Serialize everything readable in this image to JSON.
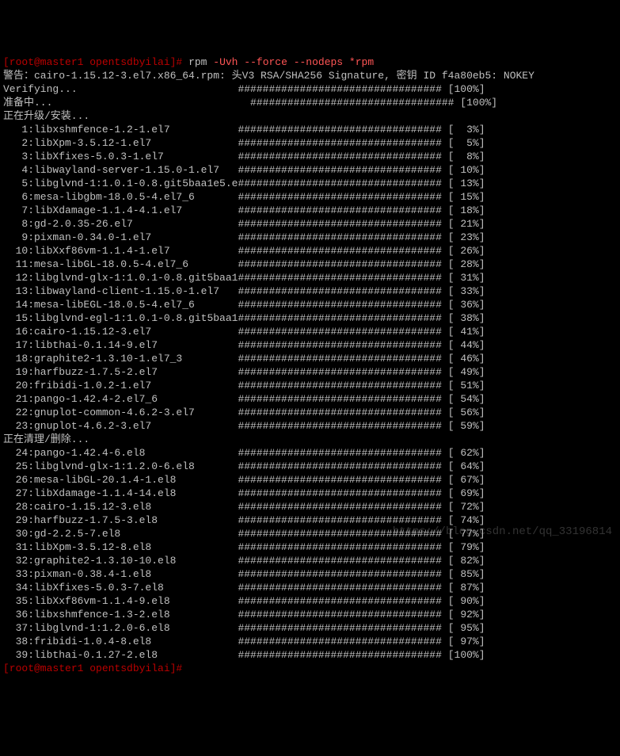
{
  "prompt": {
    "user_host_path": "[root@master1 opentsdbyilai]#",
    "command": "rpm",
    "flags": "-Uvh --force --nodeps",
    "glob": "*rpm"
  },
  "warning_line": "警告：cairo-1.15.12-3.el7.x86_64.rpm: 头V3 RSA/SHA256 Signature, 密钥 ID f4a80eb5: NOKEY",
  "verifying_label": "Verifying...",
  "verifying_bar": "################################# [100%]",
  "preparing_label": "准备中...",
  "preparing_bar": "################################# [100%]",
  "upgrade_header": "正在升级/安装...",
  "cleanup_header": "正在清理/删除...",
  "upgrade_items": [
    {
      "n": " 1",
      "name": "libxshmfence-1.2-1.el7",
      "pct": "  3%"
    },
    {
      "n": " 2",
      "name": "libXpm-3.5.12-1.el7",
      "pct": "  5%"
    },
    {
      "n": " 3",
      "name": "libXfixes-5.0.3-1.el7",
      "pct": "  8%"
    },
    {
      "n": " 4",
      "name": "libwayland-server-1.15.0-1.el7",
      "pct": " 10%"
    },
    {
      "n": " 5",
      "name": "libglvnd-1:1.0.1-0.8.git5baa1e5.e",
      "pct": " 13%"
    },
    {
      "n": " 6",
      "name": "mesa-libgbm-18.0.5-4.el7_6",
      "pct": " 15%"
    },
    {
      "n": " 7",
      "name": "libXdamage-1.1.4-4.1.el7",
      "pct": " 18%"
    },
    {
      "n": " 8",
      "name": "gd-2.0.35-26.el7",
      "pct": " 21%"
    },
    {
      "n": " 9",
      "name": "pixman-0.34.0-1.el7",
      "pct": " 23%"
    },
    {
      "n": "10",
      "name": "libXxf86vm-1.1.4-1.el7",
      "pct": " 26%"
    },
    {
      "n": "11",
      "name": "mesa-libGL-18.0.5-4.el7_6",
      "pct": " 28%"
    },
    {
      "n": "12",
      "name": "libglvnd-glx-1:1.0.1-0.8.git5baa1",
      "pct": " 31%"
    },
    {
      "n": "13",
      "name": "libwayland-client-1.15.0-1.el7",
      "pct": " 33%"
    },
    {
      "n": "14",
      "name": "mesa-libEGL-18.0.5-4.el7_6",
      "pct": " 36%"
    },
    {
      "n": "15",
      "name": "libglvnd-egl-1:1.0.1-0.8.git5baa1",
      "pct": " 38%"
    },
    {
      "n": "16",
      "name": "cairo-1.15.12-3.el7",
      "pct": " 41%"
    },
    {
      "n": "17",
      "name": "libthai-0.1.14-9.el7",
      "pct": " 44%"
    },
    {
      "n": "18",
      "name": "graphite2-1.3.10-1.el7_3",
      "pct": " 46%"
    },
    {
      "n": "19",
      "name": "harfbuzz-1.7.5-2.el7",
      "pct": " 49%"
    },
    {
      "n": "20",
      "name": "fribidi-1.0.2-1.el7",
      "pct": " 51%"
    },
    {
      "n": "21",
      "name": "pango-1.42.4-2.el7_6",
      "pct": " 54%"
    },
    {
      "n": "22",
      "name": "gnuplot-common-4.6.2-3.el7",
      "pct": " 56%"
    },
    {
      "n": "23",
      "name": "gnuplot-4.6.2-3.el7",
      "pct": " 59%"
    }
  ],
  "cleanup_items": [
    {
      "n": "24",
      "name": "pango-1.42.4-6.el8",
      "pct": " 62%"
    },
    {
      "n": "25",
      "name": "libglvnd-glx-1:1.2.0-6.el8",
      "pct": " 64%"
    },
    {
      "n": "26",
      "name": "mesa-libGL-20.1.4-1.el8",
      "pct": " 67%"
    },
    {
      "n": "27",
      "name": "libXdamage-1.1.4-14.el8",
      "pct": " 69%"
    },
    {
      "n": "28",
      "name": "cairo-1.15.12-3.el8",
      "pct": " 72%"
    },
    {
      "n": "29",
      "name": "harfbuzz-1.7.5-3.el8",
      "pct": " 74%"
    },
    {
      "n": "30",
      "name": "gd-2.2.5-7.el8",
      "pct": " 77%"
    },
    {
      "n": "31",
      "name": "libXpm-3.5.12-8.el8",
      "pct": " 79%"
    },
    {
      "n": "32",
      "name": "graphite2-1.3.10-10.el8",
      "pct": " 82%"
    },
    {
      "n": "33",
      "name": "pixman-0.38.4-1.el8",
      "pct": " 85%"
    },
    {
      "n": "34",
      "name": "libXfixes-5.0.3-7.el8",
      "pct": " 87%"
    },
    {
      "n": "35",
      "name": "libXxf86vm-1.1.4-9.el8",
      "pct": " 90%"
    },
    {
      "n": "36",
      "name": "libxshmfence-1.3-2.el8",
      "pct": " 92%"
    },
    {
      "n": "37",
      "name": "libglvnd-1:1.2.0-6.el8",
      "pct": " 95%"
    },
    {
      "n": "38",
      "name": "fribidi-1.0.4-8.el8",
      "pct": " 97%"
    },
    {
      "n": "39",
      "name": "libthai-0.1.27-2.el8",
      "pct": "100%"
    }
  ],
  "end_prompt": "[root@master1 opentsdbyilai]#",
  "watermark": "https://blog.csdn.net/qq_33196814"
}
